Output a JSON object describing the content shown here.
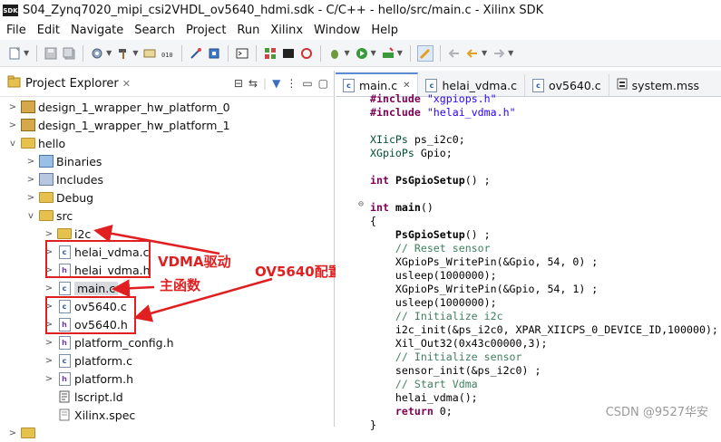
{
  "window": {
    "title": "S04_Zynq7020_mipi_csi2VHDL_ov5640_hdmi.sdk - C/C++ - hello/src/main.c - Xilinx SDK",
    "logo": "SDK"
  },
  "menu": [
    "File",
    "Edit",
    "Navigate",
    "Search",
    "Project",
    "Run",
    "Xilinx",
    "Window",
    "Help"
  ],
  "explorer": {
    "title": "Project Explorer",
    "items": [
      {
        "label": "design_1_wrapper_hw_platform_0",
        "kind": "proj",
        "depth": 0,
        "expand": ">"
      },
      {
        "label": "design_1_wrapper_hw_platform_1",
        "kind": "proj",
        "depth": 0,
        "expand": ">"
      },
      {
        "label": "hello",
        "kind": "folder",
        "depth": 0,
        "expand": "v"
      },
      {
        "label": "Binaries",
        "kind": "bin",
        "depth": 1,
        "expand": ">"
      },
      {
        "label": "Includes",
        "kind": "inc",
        "depth": 1,
        "expand": ">"
      },
      {
        "label": "Debug",
        "kind": "folder",
        "depth": 1,
        "expand": ">"
      },
      {
        "label": "src",
        "kind": "folder",
        "depth": 1,
        "expand": "v"
      },
      {
        "label": "i2c",
        "kind": "folder",
        "depth": 2,
        "expand": ">"
      },
      {
        "label": "helai_vdma.c",
        "kind": "c",
        "depth": 2,
        "expand": ">"
      },
      {
        "label": "helai_vdma.h",
        "kind": "h",
        "depth": 2,
        "expand": ">"
      },
      {
        "label": "main.c",
        "kind": "c",
        "depth": 2,
        "expand": ">"
      },
      {
        "label": "ov5640.c",
        "kind": "c",
        "depth": 2,
        "expand": ">"
      },
      {
        "label": "ov5640.h",
        "kind": "h",
        "depth": 2,
        "expand": ">"
      },
      {
        "label": "platform_config.h",
        "kind": "h",
        "depth": 2,
        "expand": ">"
      },
      {
        "label": "platform.c",
        "kind": "c",
        "depth": 2,
        "expand": ">"
      },
      {
        "label": "platform.h",
        "kind": "h",
        "depth": 2,
        "expand": ">"
      },
      {
        "label": "lscript.ld",
        "kind": "ld",
        "depth": 2,
        "expand": ""
      },
      {
        "label": "Xilinx.spec",
        "kind": "spec",
        "depth": 2,
        "expand": ""
      }
    ]
  },
  "annotations": {
    "vdma": "VDMA驱动",
    "ov5640": "OV5640配置",
    "main": "主函数"
  },
  "tabs": [
    "main.c",
    "helai_vdma.c",
    "ov5640.c",
    "system.mss"
  ],
  "code": [
    "#include \"xgpiops.h\"",
    "#include \"helai_vdma.h\"",
    "",
    "XIicPs ps_i2c0;",
    "XGpioPs Gpio;",
    "",
    "int PsGpioSetup() ;",
    "",
    "int main()",
    "{",
    "    PsGpioSetup() ;",
    "    // Reset sensor",
    "    XGpioPs_WritePin(&Gpio, 54, 0) ;",
    "    usleep(1000000);",
    "    XGpioPs_WritePin(&Gpio, 54, 1) ;",
    "    usleep(1000000);",
    "    // Initialize i2c",
    "    i2c_init(&ps_i2c0, XPAR_XIICPS_0_DEVICE_ID,100000);",
    "    Xil_Out32(0x43c00000,3);",
    "    // Initialize sensor",
    "    sensor_init(&ps_i2c0) ;",
    "    // Start Vdma",
    "    helai_vdma();",
    "    return 0;",
    "}"
  ],
  "watermark": "CSDN @9527华安"
}
